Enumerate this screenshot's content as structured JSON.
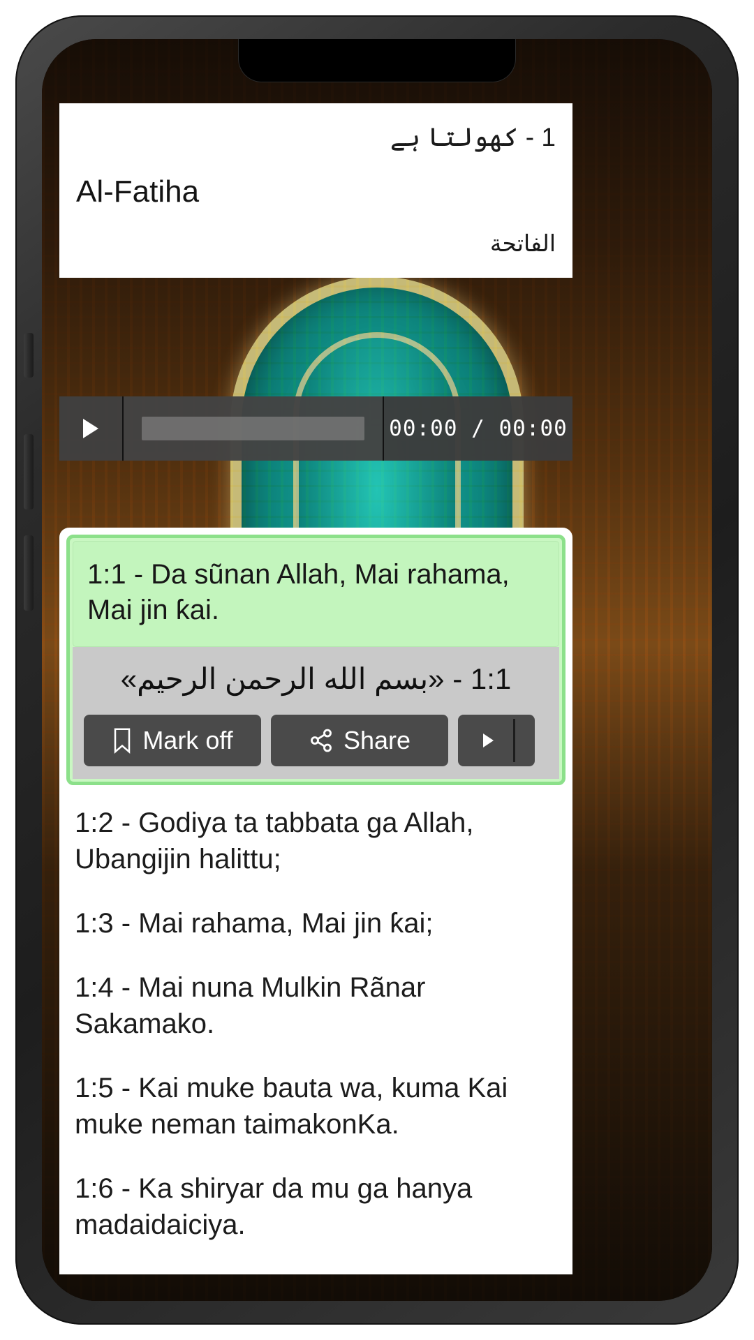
{
  "header": {
    "line1": "1 - کھولتا ہے",
    "title": "Al-Fatiha",
    "arabic": "الفاتحة"
  },
  "player": {
    "play_label": "play-icon",
    "time": "00:00 / 00:00",
    "progress_percent": 0
  },
  "active_verse": {
    "text": "1:1 - Da sũnan Allah, Mai rahama, Mai jin ƙai.",
    "arabic": "1:1 - «بسم الله الرحمن الرحيم»",
    "actions": {
      "mark_label": "Mark off",
      "share_label": "Share",
      "play_label": "play-icon"
    }
  },
  "verses": [
    {
      "ref": "1:2",
      "text": "1:2 - Godiya ta tabbata ga Allah, Ubangijin halittu;"
    },
    {
      "ref": "1:3",
      "text": "1:3 - Mai rahama, Mai jin ƙai;"
    },
    {
      "ref": "1:4",
      "text": "1:4 - Mai nuna Mulkin Rãnar Sakamako."
    },
    {
      "ref": "1:5",
      "text": "1:5 - Kai muke bauta wa, kuma Kai muke neman taimakonKa."
    },
    {
      "ref": "1:6",
      "text": "1:6 - Ka shiryar da mu ga hanya madaidaiciya."
    }
  ],
  "colors": {
    "highlight_border": "#8ce08a",
    "highlight_fill": "#c3f5bd",
    "arabic_band": "#c9c9c9",
    "button_bg": "#4a4a4a",
    "player_bg": "#3a3a3a"
  }
}
